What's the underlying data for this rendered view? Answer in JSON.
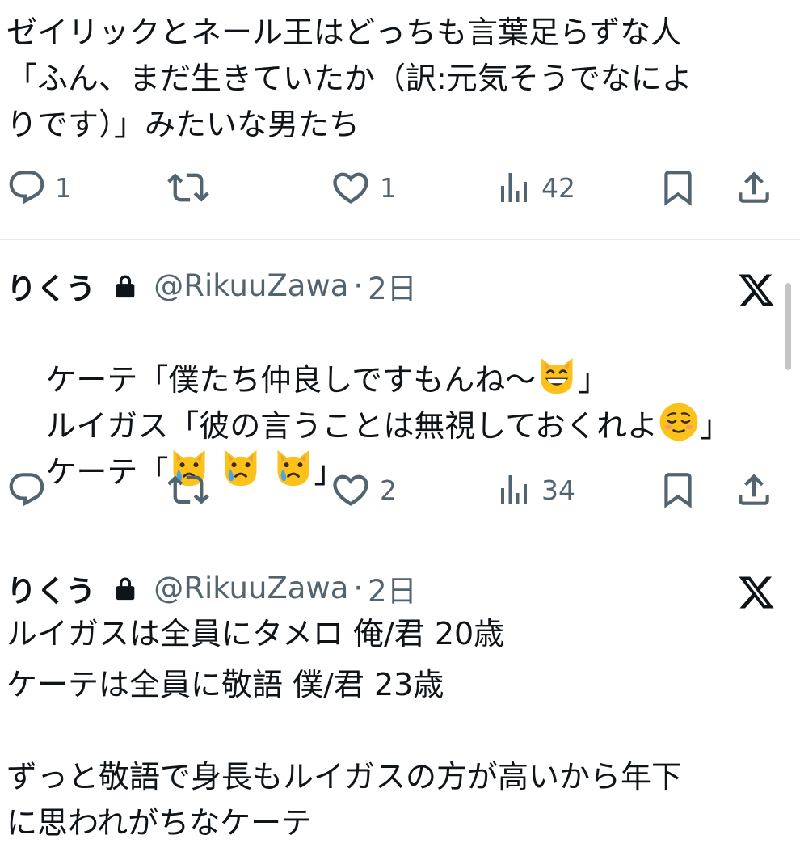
{
  "tweet1": {
    "lines": [
      "ゼイリックとネール王はどっちも言葉足らずな人",
      "「ふん、まだ生きていたか（訳:元気そうでなによ",
      "りです）」みたいな男たち"
    ],
    "actions": {
      "replies": "1",
      "retweets": "",
      "likes": "1",
      "views": "42"
    }
  },
  "tweet2": {
    "author": {
      "name": "りくう",
      "handle": "@RikuuZawa",
      "separator": "·",
      "time": "2日"
    },
    "lines": [
      {
        "before": "ケーテ「僕たち仲良しですもんね～",
        "after": "」"
      },
      {
        "before": "ルイガス「彼の言うことは無視しておくれよ",
        "after": "」"
      },
      {
        "before": "ケーテ「",
        "after": "」"
      }
    ],
    "emoji": [
      "grinning-cat",
      "relieved-face",
      "crying-cat",
      "crying-cat",
      "crying-cat"
    ],
    "actions": {
      "replies": "",
      "retweets": "",
      "likes": "2",
      "views": "34"
    }
  },
  "tweet3": {
    "author": {
      "name": "りくう",
      "handle": "@RikuuZawa",
      "separator": "·",
      "time": "2日"
    },
    "lines": [
      "ルイガスは全員にタメロ 俺/君 20歳",
      "ケーテは全員に敬語 僕/君 23歳",
      "",
      "ずっと敬語で身長もルイガスの方が高いから年下",
      "に思われがちなケーテ"
    ]
  },
  "colors": {
    "text": "#0f1419",
    "secondary": "#536471",
    "divider": "#e7e9ea"
  },
  "icons": [
    "reply-icon",
    "retweet-icon",
    "like-icon",
    "views-icon",
    "bookmark-icon",
    "share-icon",
    "lock-icon",
    "x-logo-icon"
  ]
}
